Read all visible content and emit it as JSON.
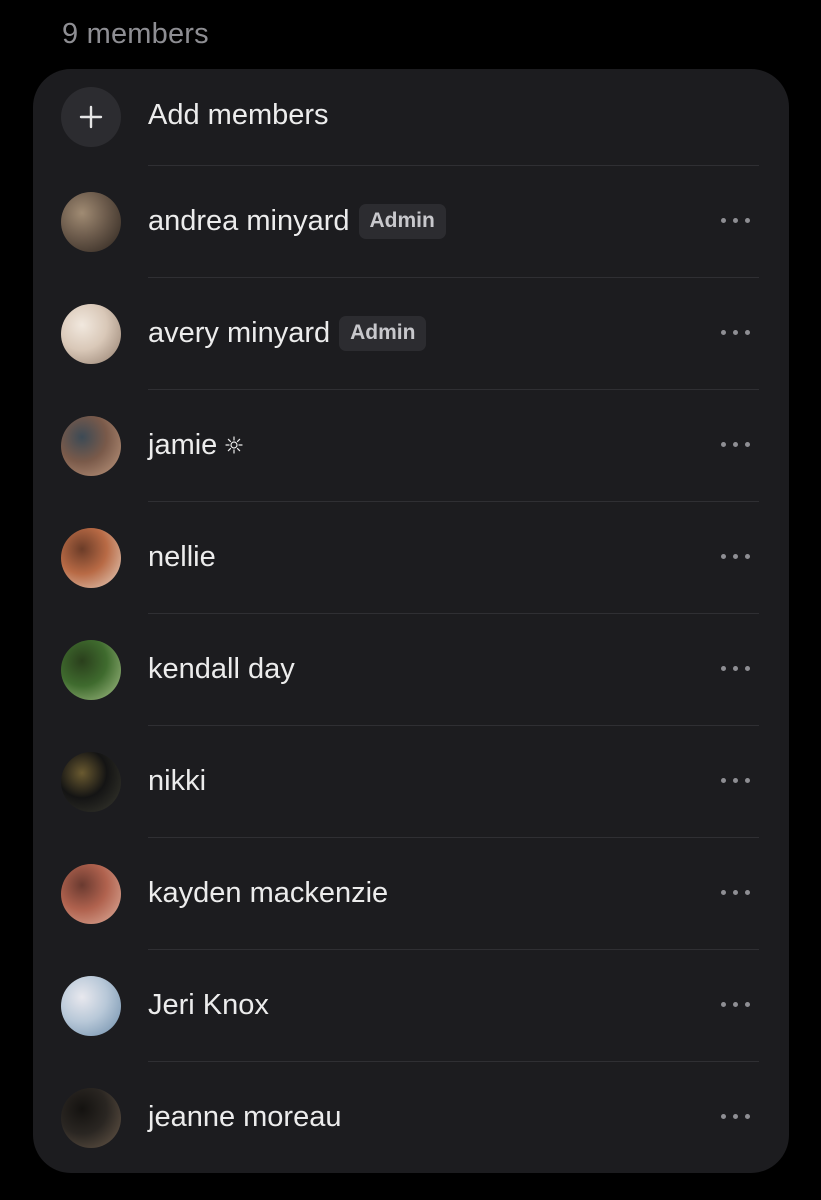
{
  "header": {
    "member_count_label": "9 members"
  },
  "add_members": {
    "label": "Add members"
  },
  "members": [
    {
      "name": "andrea minyard",
      "badge": "Admin",
      "avatar_colors": [
        "#6b5a4b",
        "#2a221c",
        "#a08b73"
      ]
    },
    {
      "name": "avery minyard",
      "badge": "Admin",
      "avatar_colors": [
        "#d9c8b8",
        "#8f7a6a",
        "#f1e8de"
      ]
    },
    {
      "name": "jamie",
      "icon": "sun-icon",
      "avatar_colors": [
        "#7a5a4a",
        "#c09a80",
        "#3c4a55"
      ]
    },
    {
      "name": "nellie",
      "avatar_colors": [
        "#b86a45",
        "#e8d4c4",
        "#6b3c28"
      ]
    },
    {
      "name": "kendall day",
      "avatar_colors": [
        "#3f6b2e",
        "#a8c28a",
        "#2a3f1c"
      ]
    },
    {
      "name": "nikki",
      "avatar_colors": [
        "#141414",
        "#3a3a30",
        "#6a5a30"
      ]
    },
    {
      "name": "kayden mackenzie",
      "avatar_colors": [
        "#b0624e",
        "#e0b2a0",
        "#6a3a30"
      ]
    },
    {
      "name": "Jeri Knox",
      "avatar_colors": [
        "#b8c8d8",
        "#6a8aa8",
        "#e8e8ee"
      ]
    },
    {
      "name": "jeanne moreau",
      "avatar_colors": [
        "#2a2622",
        "#6a5a4a",
        "#141210"
      ]
    }
  ]
}
